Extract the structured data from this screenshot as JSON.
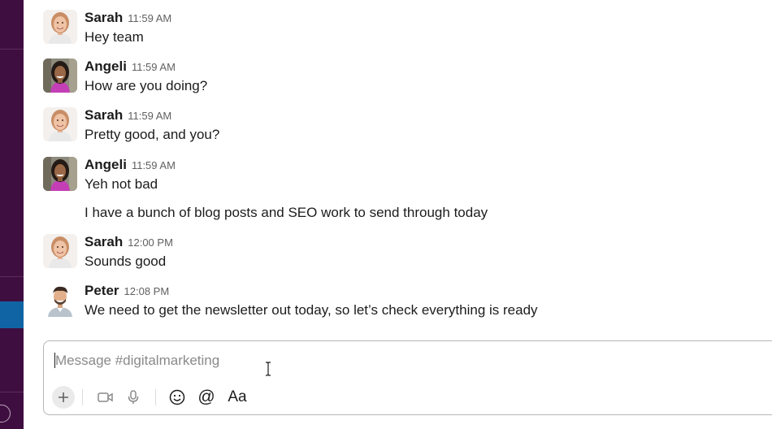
{
  "channel": "digitalmarketing",
  "messages": [
    {
      "sender": "Sarah",
      "time": "11:59 AM",
      "lines": [
        "Hey team"
      ],
      "avatar": "sarah-avatar"
    },
    {
      "sender": "Angeli",
      "time": "11:59 AM",
      "lines": [
        "How are you doing?"
      ],
      "avatar": "angeli-avatar"
    },
    {
      "sender": "Sarah",
      "time": "11:59 AM",
      "lines": [
        "Pretty good, and you?"
      ],
      "avatar": "sarah-avatar"
    },
    {
      "sender": "Angeli",
      "time": "11:59 AM",
      "lines": [
        "Yeh not bad",
        "I have a bunch of blog posts and SEO work to send through today"
      ],
      "avatar": "angeli-avatar"
    },
    {
      "sender": "Sarah",
      "time": "12:00 PM",
      "lines": [
        "Sounds good"
      ],
      "avatar": "sarah-avatar"
    },
    {
      "sender": "Peter",
      "time": "12:08 PM",
      "lines": [
        "We need to get the newsletter out today, so let’s check everything is ready"
      ],
      "avatar": "peter-avatar"
    }
  ],
  "composer": {
    "placeholder": "Message #digitalmarketing",
    "format_label": "Aa",
    "at_label": "@"
  },
  "colors": {
    "sidebar": "#3f0e40",
    "sidebar_active": "#1164a3",
    "text": "#1d1c1d",
    "muted": "#616061"
  },
  "icons": [
    "plus-icon",
    "video-icon",
    "microphone-icon",
    "emoji-icon",
    "mention-icon",
    "formatting-icon",
    "help-icon"
  ]
}
